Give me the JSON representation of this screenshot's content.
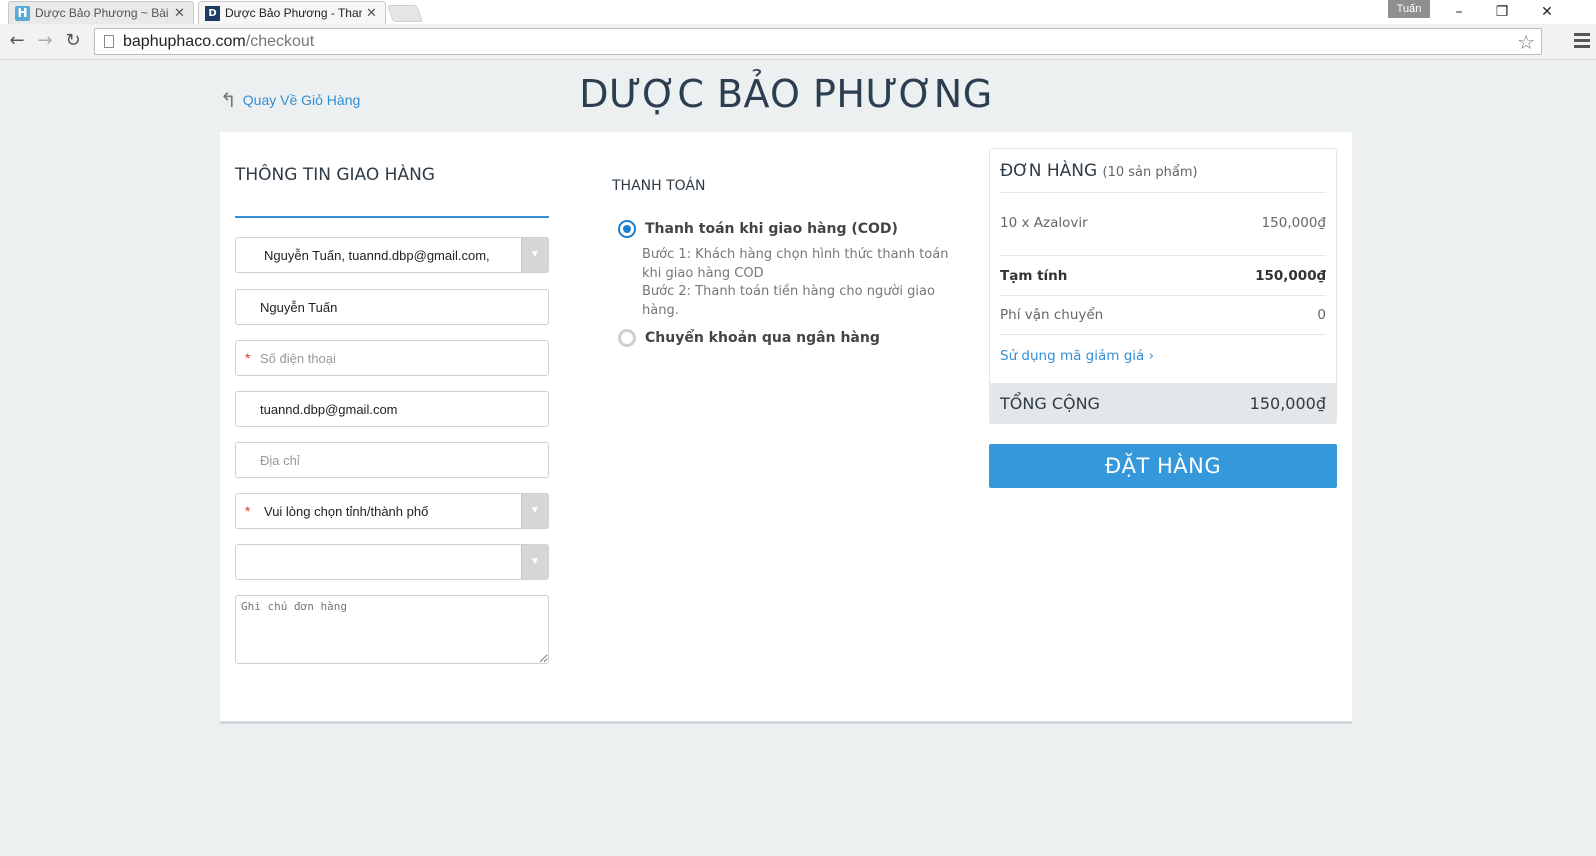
{
  "browser": {
    "tabs": [
      {
        "favicon": "H",
        "title": "Dược Bảo Phương ~ Bài vi"
      },
      {
        "favicon": "D",
        "title": "Dược Bảo Phương - Thanh"
      }
    ],
    "user": "Tuấn",
    "url_host": "baphuphaco.com",
    "url_path": "/checkout",
    "icons": [
      "back-arrow-icon",
      "forward-arrow-icon",
      "reload-icon",
      "page-icon",
      "star-icon",
      "menu-icon",
      "minimize-icon",
      "restore-icon",
      "close-icon"
    ]
  },
  "header": {
    "back_label": "Quay Về Giỏ Hàng",
    "shop_name": "DƯỢC BẢO PHƯƠNG"
  },
  "shipping": {
    "title": "THÔNG TIN GIAO HÀNG",
    "address_select": "Nguyễn Tuấn, tuannd.dbp@gmail.com,",
    "name": "Nguyễn Tuấn",
    "phone_placeholder": "Số điện thoại",
    "email": "tuannd.dbp@gmail.com",
    "address_placeholder": "Địa chỉ",
    "city_select": "Vui lòng chọn tỉnh/thành phố",
    "district_select": "",
    "note_placeholder": "Ghi chú đơn hàng",
    "required_mark": "*"
  },
  "payment": {
    "title": "THANH TOÁN",
    "options": [
      {
        "label": "Thanh toán khi giao hàng (COD)",
        "selected": true
      },
      {
        "label": "Chuyển khoản qua ngân hàng",
        "selected": false
      }
    ],
    "cod_step1": "Bước 1: Khách hàng chọn hình thức thanh toán khi giao hàng COD",
    "cod_step2": "Bước 2: Thanh toán tiền hàng cho người giao hàng."
  },
  "order": {
    "title": "ĐƠN HÀNG",
    "count": "(10 sản phẩm)",
    "item_name": "10 x Azalovir",
    "item_price": "150,000₫",
    "subtotal_label": "Tạm tính",
    "subtotal_value": "150,000₫",
    "shipping_label": "Phí vận chuyển",
    "shipping_value": "0",
    "discount_link": "Sử dụng mã giảm giá",
    "total_label": "TỔNG CỘNG",
    "total_value": "150,000₫",
    "submit_label": "ĐẶT HÀNG"
  },
  "colors": {
    "accent": "#3498db",
    "link": "#338fd4",
    "required": "#e03131",
    "page_bg": "#ecf0f1"
  }
}
